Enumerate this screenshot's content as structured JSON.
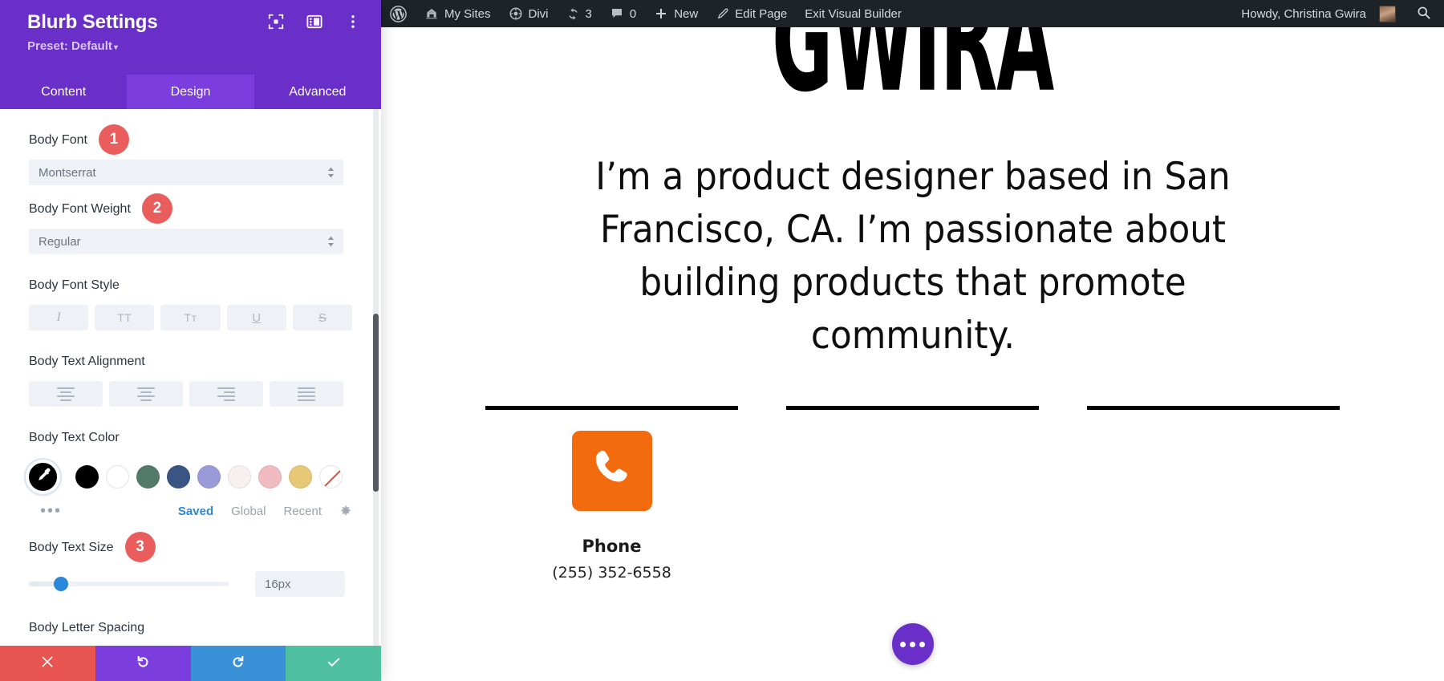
{
  "settings_panel": {
    "title": "Blurb Settings",
    "preset_label": "Preset: Default",
    "header_icons": [
      {
        "name": "focus-target-icon"
      },
      {
        "name": "layout-panel-icon"
      },
      {
        "name": "more-vertical-icon"
      }
    ],
    "tabs": [
      {
        "label": "Content",
        "active": false
      },
      {
        "label": "Design",
        "active": true
      },
      {
        "label": "Advanced",
        "active": false
      }
    ],
    "fields": {
      "body_font": {
        "label": "Body Font",
        "badge": "1",
        "value": "Montserrat"
      },
      "body_font_weight": {
        "label": "Body Font Weight",
        "badge": "2",
        "value": "Regular"
      },
      "body_font_style": {
        "label": "Body Font Style",
        "options": [
          {
            "name": "italic-button",
            "glyph": "I"
          },
          {
            "name": "uppercase-button",
            "glyph": "TT"
          },
          {
            "name": "capitalize-button",
            "glyph": "Tᴛ"
          },
          {
            "name": "underline-button",
            "glyph": "U"
          },
          {
            "name": "strikethrough-button",
            "glyph": "S"
          }
        ]
      },
      "body_text_alignment": {
        "label": "Body Text Alignment",
        "options": [
          {
            "name": "align-left-button"
          },
          {
            "name": "align-center-button"
          },
          {
            "name": "align-right-button"
          },
          {
            "name": "align-justify-button"
          }
        ]
      },
      "body_text_color": {
        "label": "Body Text Color",
        "picker_color": "#000000",
        "swatches": [
          "#000000",
          "#ffffff",
          "#537a68",
          "#3a5583",
          "#9a9ad8",
          "#f6f1f0",
          "#f0bcc2",
          "#e6c877",
          "none"
        ],
        "more_label": "•••",
        "links": [
          {
            "label": "Saved",
            "active": true
          },
          {
            "label": "Global",
            "active": false
          },
          {
            "label": "Recent",
            "active": false
          }
        ],
        "gear_name": "color-settings-gear-icon"
      },
      "body_text_size": {
        "label": "Body Text Size",
        "badge": "3",
        "value": "16px",
        "slider_percent": 16
      },
      "body_letter_spacing": {
        "label": "Body Letter Spacing"
      }
    },
    "actions": [
      {
        "name": "cancel-button",
        "icon": "close-icon"
      },
      {
        "name": "undo-button",
        "icon": "undo-icon"
      },
      {
        "name": "redo-button",
        "icon": "redo-icon"
      },
      {
        "name": "save-button",
        "icon": "check-icon"
      }
    ]
  },
  "admin_bar": {
    "items": [
      {
        "name": "wordpress-logo-icon",
        "label": ""
      },
      {
        "name": "my-sites-item",
        "label": "My Sites",
        "icon": "sites-icon"
      },
      {
        "name": "divi-item",
        "label": "Divi",
        "icon": "divi-icon"
      },
      {
        "name": "updates-item",
        "label": "3",
        "icon": "updates-icon"
      },
      {
        "name": "comments-item",
        "label": "0",
        "icon": "comment-icon"
      },
      {
        "name": "new-item",
        "label": "New",
        "icon": "plus-icon"
      },
      {
        "name": "edit-page-item",
        "label": "Edit Page",
        "icon": "pencil-icon"
      },
      {
        "name": "exit-visual-builder-item",
        "label": "Exit Visual Builder"
      }
    ],
    "greeting": "Howdy, Christina Gwira",
    "search_icon": "search-icon"
  },
  "preview": {
    "hero_word": "GWIRA",
    "paragraph": "I’m a product designer based in San Francisco, CA. I’m passionate about building products that promote community.",
    "blurb": {
      "icon": "phone-icon",
      "icon_color": "#f26b0f",
      "title": "Phone",
      "text": "(255) 352-6558"
    },
    "fab": {
      "name": "page-settings-fab",
      "icon": "more-horizontal-icon",
      "color": "#6a2ec9"
    }
  }
}
